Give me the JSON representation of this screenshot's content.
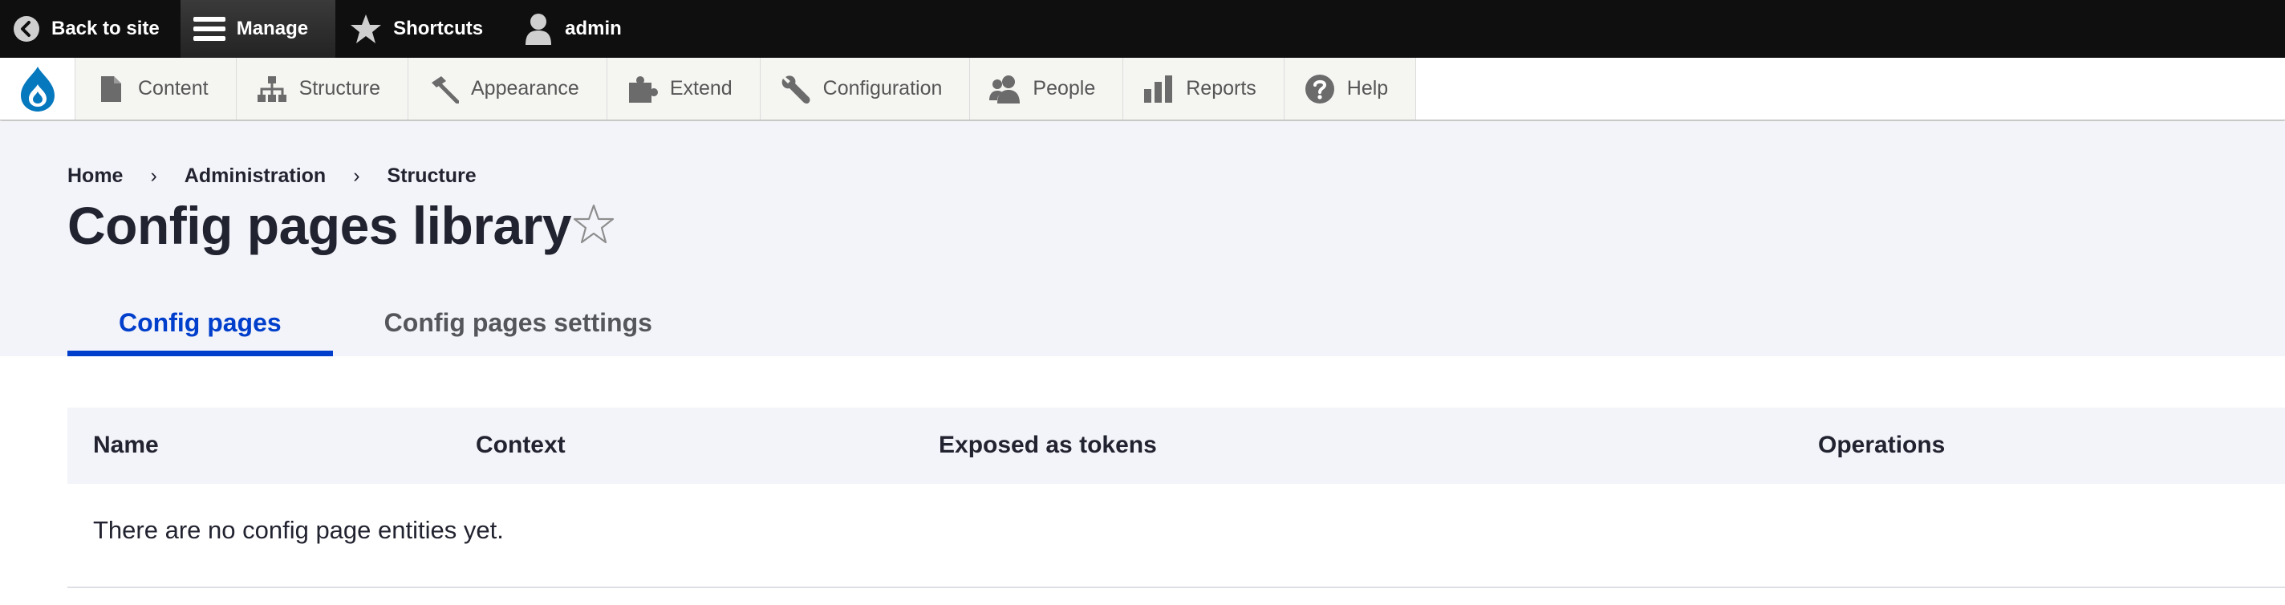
{
  "toolbar": {
    "back_to_site": "Back to site",
    "manage": "Manage",
    "shortcuts": "Shortcuts",
    "user": "admin"
  },
  "tray": {
    "items": [
      {
        "label": "Content",
        "icon": "file-icon"
      },
      {
        "label": "Structure",
        "icon": "sitemap-icon"
      },
      {
        "label": "Appearance",
        "icon": "paintbrush-icon"
      },
      {
        "label": "Extend",
        "icon": "puzzle-icon"
      },
      {
        "label": "Configuration",
        "icon": "wrench-icon"
      },
      {
        "label": "People",
        "icon": "people-icon"
      },
      {
        "label": "Reports",
        "icon": "bar-chart-icon"
      },
      {
        "label": "Help",
        "icon": "help-icon"
      }
    ]
  },
  "breadcrumb": [
    "Home",
    "Administration",
    "Structure"
  ],
  "page": {
    "title": "Config pages library"
  },
  "tabs": [
    "Config pages",
    "Config pages settings"
  ],
  "table": {
    "headers": [
      "Name",
      "Context",
      "Exposed as tokens",
      "Operations"
    ],
    "empty_text": "There are no config page entities yet."
  },
  "colors": {
    "accent": "#003ecc",
    "toolbar_bg": "#0f0f0f",
    "header_bg": "#f3f4f9",
    "drupal_blue": "#0678be"
  }
}
